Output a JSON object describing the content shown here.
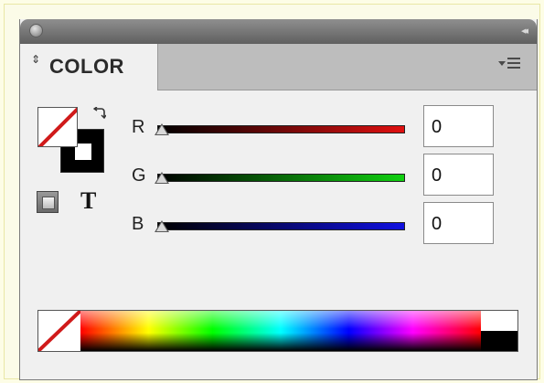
{
  "panel": {
    "title": "COLOR",
    "tab_arrow": "⇕",
    "collapse_glyph": "◂◂"
  },
  "format": {
    "text_label": "T"
  },
  "sliders": [
    {
      "label": "R",
      "value": "0",
      "color": "#e01010"
    },
    {
      "label": "G",
      "value": "0",
      "color": "#10d010"
    },
    {
      "label": "B",
      "value": "0",
      "color": "#1010e0"
    }
  ],
  "colors": {
    "none_slash": "#d01a1a",
    "titlebar": "#6f6f6f",
    "tab_strip": "#bdbdbd"
  },
  "icons": {
    "panel_menu": "panel-menu-icon",
    "swap": "swap-fill-stroke-icon",
    "close": "close-icon",
    "collapse": "collapse-icon"
  }
}
